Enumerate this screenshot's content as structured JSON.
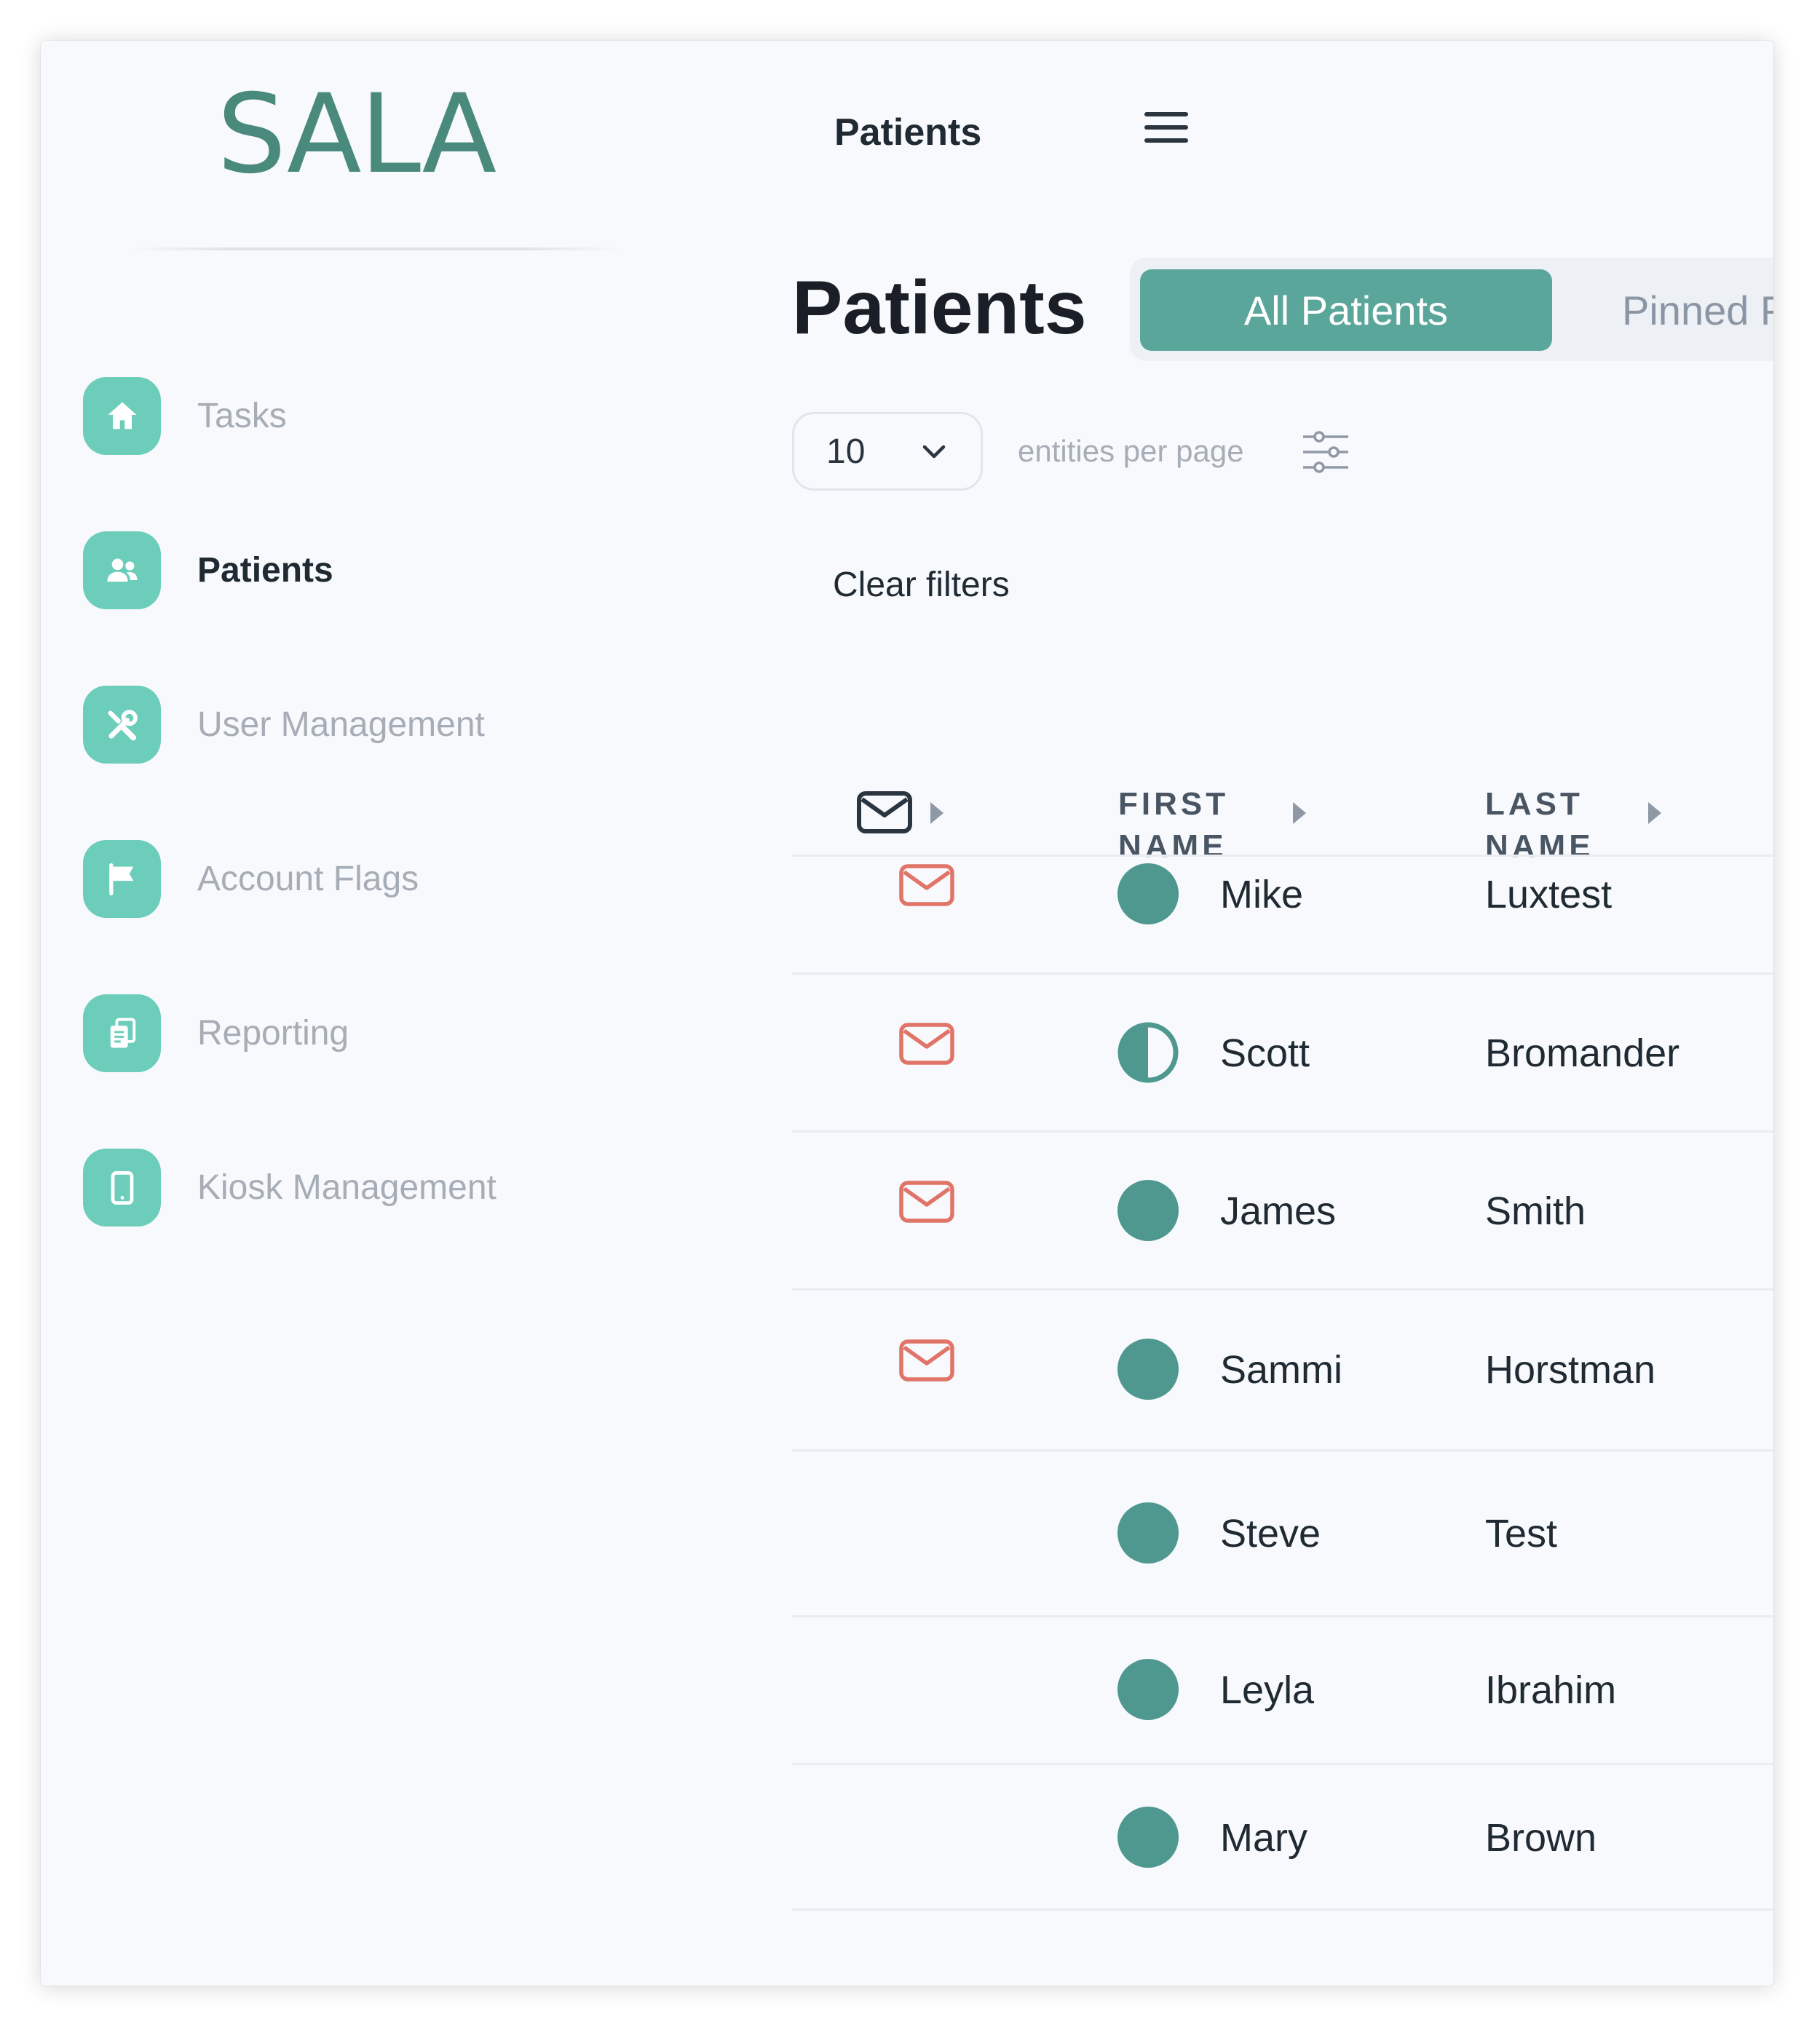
{
  "app": {
    "logo": "SALA"
  },
  "topbar": {
    "title": "Patients",
    "menu_icon": "hamburger-icon"
  },
  "sidebar": {
    "items": [
      {
        "label": "Tasks",
        "icon": "home-icon",
        "active": false
      },
      {
        "label": "Patients",
        "icon": "users-icon",
        "active": true
      },
      {
        "label": "User Management",
        "icon": "tools-icon",
        "active": false
      },
      {
        "label": "Account Flags",
        "icon": "flag-icon",
        "active": false
      },
      {
        "label": "Reporting",
        "icon": "documents-icon",
        "active": false
      },
      {
        "label": "Kiosk Management",
        "icon": "tablet-icon",
        "active": false
      }
    ]
  },
  "main": {
    "title": "Patients",
    "tabs": [
      {
        "label": "All Patients",
        "selected": true
      },
      {
        "label": "Pinned P",
        "selected": false
      }
    ],
    "per_page": {
      "value": "10",
      "label": "entities per page"
    },
    "clear_filters": "Clear filters",
    "table": {
      "columns": [
        {
          "key": "contact",
          "label": "",
          "icon": "mail-icon"
        },
        {
          "key": "first_name",
          "label_lines": [
            "FIRST",
            "NAME"
          ]
        },
        {
          "key": "last_name",
          "label_lines": [
            "LAST",
            "NAME"
          ]
        }
      ],
      "rows": [
        {
          "has_mail": true,
          "status": "full",
          "first_name": "Mike",
          "last_name": "Luxtest"
        },
        {
          "has_mail": true,
          "status": "half",
          "first_name": "Scott",
          "last_name": "Bromander"
        },
        {
          "has_mail": true,
          "status": "full",
          "first_name": "James",
          "last_name": "Smith"
        },
        {
          "has_mail": true,
          "status": "full",
          "first_name": "Sammi",
          "last_name": "Horstman"
        },
        {
          "has_mail": false,
          "status": "full",
          "first_name": "Steve",
          "last_name": "Test"
        },
        {
          "has_mail": false,
          "status": "full",
          "first_name": "Leyla",
          "last_name": "Ibrahim"
        },
        {
          "has_mail": false,
          "status": "full",
          "first_name": "Mary",
          "last_name": "Brown"
        }
      ]
    }
  },
  "colors": {
    "accent": "#5aa69a",
    "nav_icon_bg": "#6ccdbb",
    "logo": "#4a8a7c",
    "status_dot": "#4f9890",
    "mail_alert": "#e07468",
    "muted_text": "#a6adb6"
  }
}
